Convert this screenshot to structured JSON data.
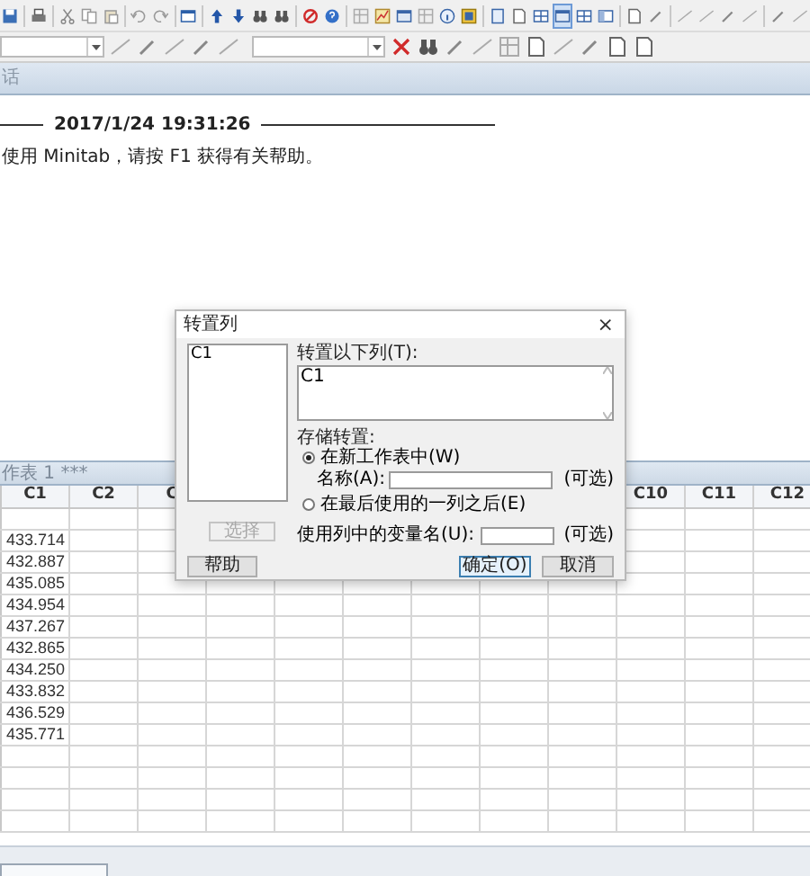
{
  "session": {
    "title": "话",
    "timestamp": "2017/1/24 19:31:26",
    "message": "使用 Minitab，请按 F1 获得有关帮助。"
  },
  "worksheet": {
    "title": "作表 1 ***",
    "columns_left": [
      "C1",
      "C2",
      "C"
    ],
    "columns_right": [
      "C10",
      "C11",
      "C12"
    ],
    "rows": [
      "433.714",
      "432.887",
      "435.085",
      "434.954",
      "437.267",
      "432.865",
      "434.250",
      "433.832",
      "436.529",
      "435.771"
    ]
  },
  "dialog": {
    "title": "转置列",
    "close": "×",
    "list_items": [
      "C1"
    ],
    "columns_label": "转置以下列(T):",
    "columns_value": "C1",
    "store_label": "存储转置:",
    "options": [
      {
        "label": "在新工作表中(W)",
        "selected": true
      },
      {
        "label": "在最后使用的一列之后(E)",
        "selected": false
      }
    ],
    "name_label": "名称(A):",
    "name_hint": "(可选)",
    "varnames_label": "使用列中的变量名(U):",
    "varnames_hint": "(可选)",
    "buttons": [
      {
        "label": "选择",
        "disabled": true
      },
      {
        "label": "帮助",
        "disabled": false
      },
      {
        "label": "确定(O)",
        "disabled": false
      },
      {
        "label": "取消",
        "disabled": false
      }
    ]
  }
}
